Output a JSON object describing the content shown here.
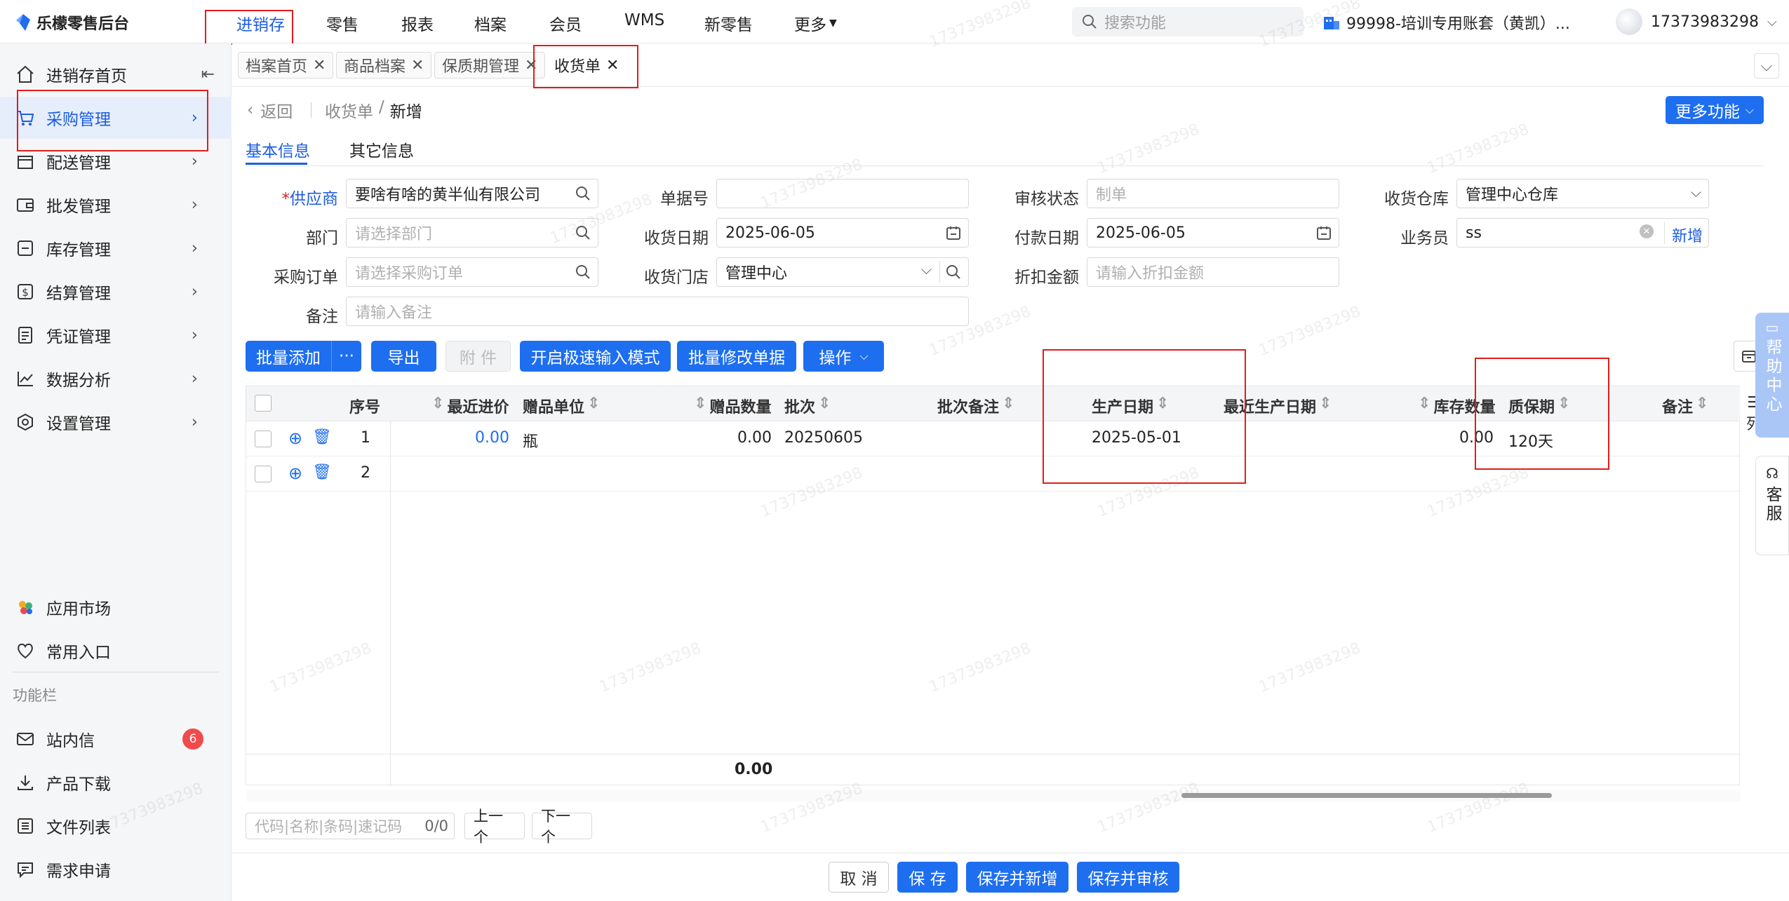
{
  "app": {
    "logo_text": "乐檬零售后台"
  },
  "topnav": [
    "进销存",
    "零售",
    "报表",
    "档案",
    "会员",
    "WMS",
    "新零售",
    "更多"
  ],
  "search_placeholder": "搜索功能",
  "account": "99998-培训专用账套（黄凯）...",
  "user": "17373983298",
  "sidebar": {
    "items": [
      "进销存首页",
      "采购管理",
      "配送管理",
      "批发管理",
      "库存管理",
      "结算管理",
      "凭证管理",
      "数据分析",
      "设置管理"
    ],
    "extra": [
      "应用市场",
      "常用入口"
    ],
    "section_title": "功能栏",
    "tools": [
      "站内信",
      "产品下载",
      "文件列表",
      "需求申请"
    ],
    "badge_count": "6"
  },
  "tabs": [
    "档案首页",
    "商品档案",
    "保质期管理",
    "收货单"
  ],
  "breadcrumb": {
    "back": "返回",
    "parent": "收货单",
    "sep": "/",
    "current": "新增"
  },
  "more_btn": "更多功能",
  "subtabs": [
    "基本信息",
    "其它信息"
  ],
  "form": {
    "supplier_label": "供应商",
    "supplier_value": "要啥有啥的黄半仙有限公司",
    "dept_label": "部门",
    "dept_ph": "请选择部门",
    "po_label": "采购订单",
    "po_ph": "请选择采购订单",
    "remark_label": "备注",
    "remark_ph": "请输入备注",
    "docno_label": "单据号",
    "recv_date_label": "收货日期",
    "recv_date": "2025-06-05",
    "store_label": "收货门店",
    "store_value": "管理中心",
    "audit_label": "审核状态",
    "audit_ph": "制单",
    "pay_date_label": "付款日期",
    "pay_date": "2025-06-05",
    "discount_label": "折扣金额",
    "discount_ph": "请输入折扣金额",
    "warehouse_label": "收货仓库",
    "warehouse_value": "管理中心仓库",
    "salesman_label": "业务员",
    "salesman_value": "ss",
    "add_link": "新增"
  },
  "toolbar": {
    "batch_add": "批量添加",
    "more": "···",
    "export": "导出",
    "attach": "附 件",
    "fast_mode": "开启极速输入模式",
    "batch_edit": "批量修改单据",
    "ops": "操作"
  },
  "table": {
    "headers": [
      "序号",
      "最近进价",
      "赠品单位",
      "赠品数量",
      "批次",
      "批次备注",
      "生产日期",
      "最近生产日期",
      "库存数量",
      "质保期",
      "备注"
    ],
    "rows": [
      {
        "no": "1",
        "price": "0.00",
        "unit": "瓶",
        "gift_qty": "0.00",
        "batch": "20250605",
        "prod_date": "2025-05-01",
        "stock": "0.00",
        "shelf": "120天"
      },
      {
        "no": "2"
      }
    ],
    "total": "0.00",
    "col_icon_label": "列"
  },
  "finder": {
    "placeholder": "代码|名称|条码|速记码",
    "count": "0/0",
    "prev": "上一个",
    "next": "下一个"
  },
  "footer": {
    "cancel": "取 消",
    "save": "保 存",
    "save_new": "保存并新增",
    "save_audit": "保存并审核"
  },
  "float": {
    "help": "帮助中心",
    "service": "客服"
  },
  "watermark": "17373983298",
  "colors": {
    "accent": "#1e6ef0",
    "highlight": "#e21c1c"
  }
}
